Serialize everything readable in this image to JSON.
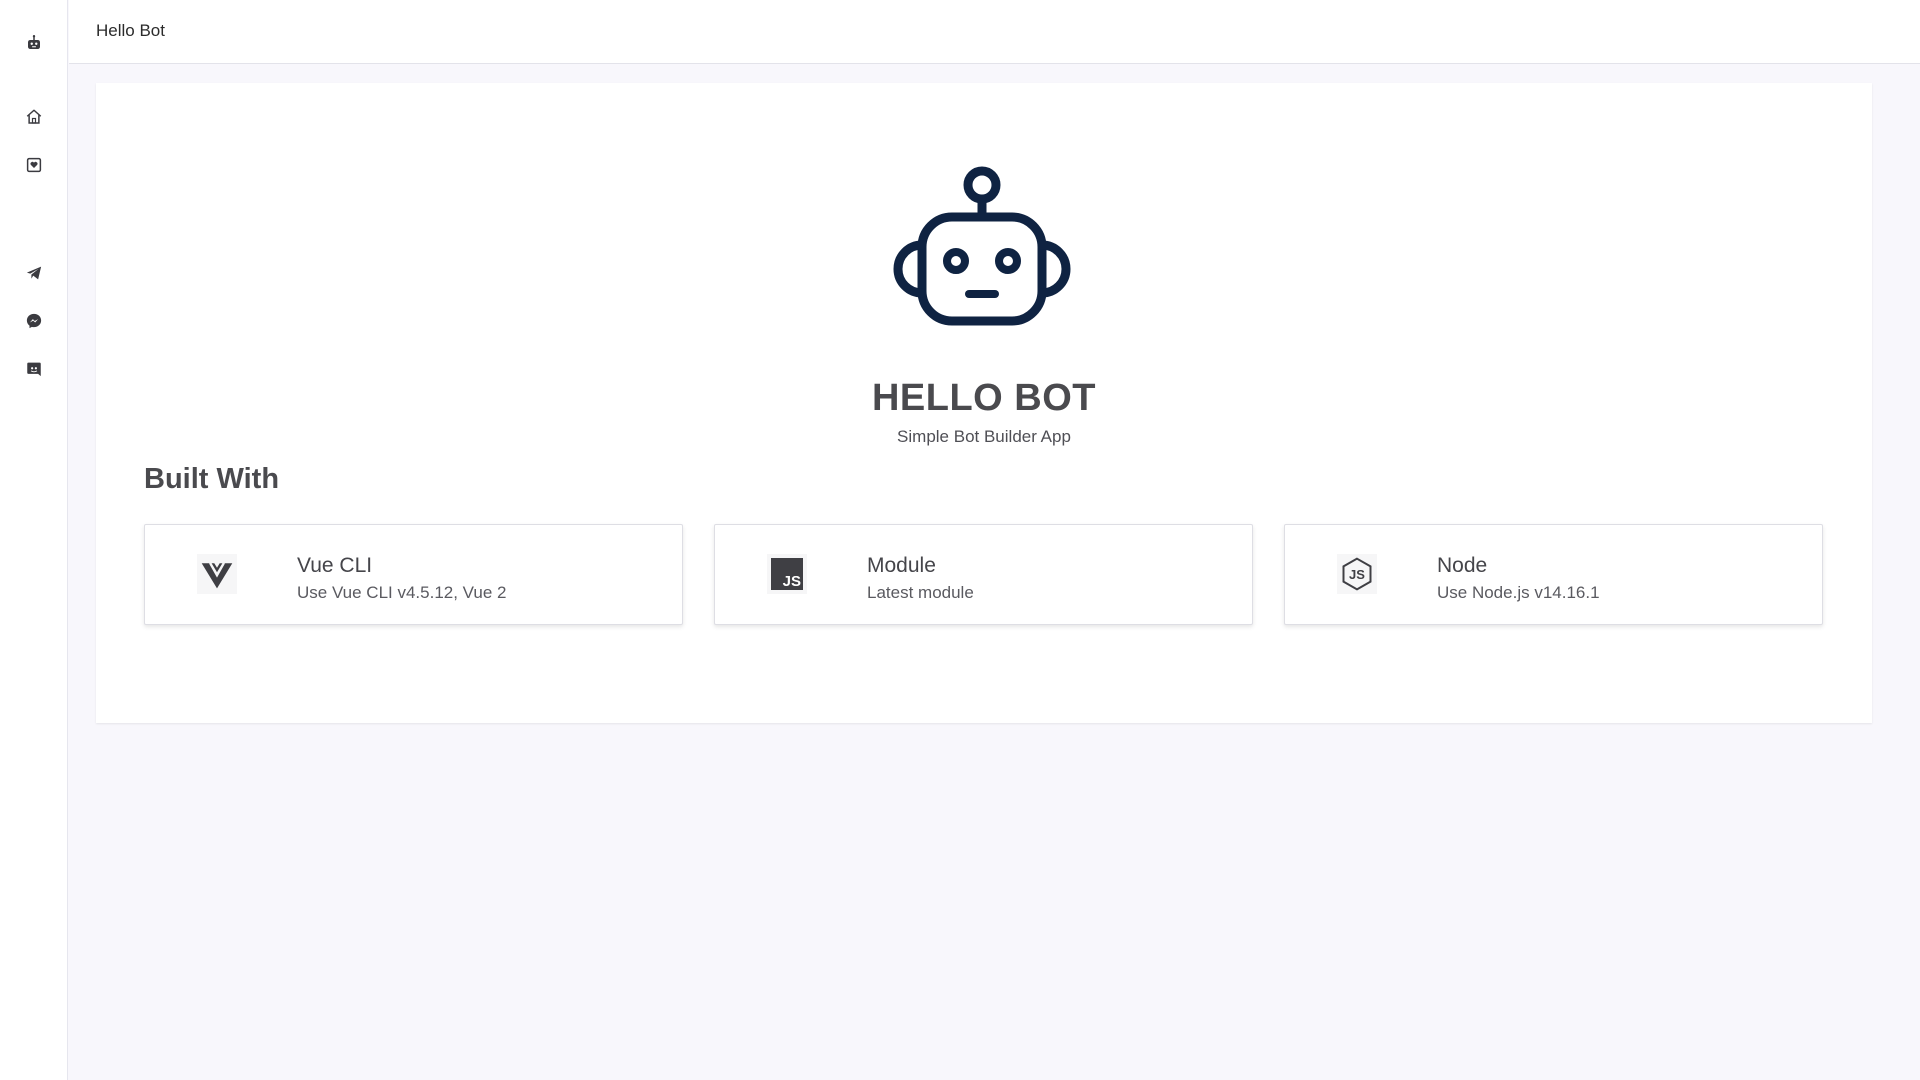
{
  "header": {
    "title": "Hello Bot"
  },
  "sidebar": {
    "logo_icon": "robot-icon",
    "items": [
      {
        "icon": "home-icon"
      },
      {
        "icon": "heart-inbox-icon"
      },
      {
        "icon": "telegram-icon"
      },
      {
        "icon": "messenger-icon"
      },
      {
        "icon": "discord-icon"
      }
    ]
  },
  "hero": {
    "icon": "robot-icon",
    "title": "HELLO BOT",
    "subtitle": "Simple Bot Builder App"
  },
  "built_with": {
    "heading": "Built With",
    "cards": [
      {
        "icon": "vue-icon",
        "title": "Vue CLI",
        "description": "Use Vue CLI v4.5.12, Vue 2"
      },
      {
        "icon": "js-icon",
        "icon_text": "JS",
        "title": "Module",
        "description": "Latest module"
      },
      {
        "icon": "nodejs-icon",
        "icon_text": "JS",
        "title": "Node",
        "description": "Use Node.js v14.16.1"
      }
    ]
  },
  "colors": {
    "accent": "#0f2342",
    "background": "#f8f7fc",
    "text": "#4a4a4e"
  }
}
